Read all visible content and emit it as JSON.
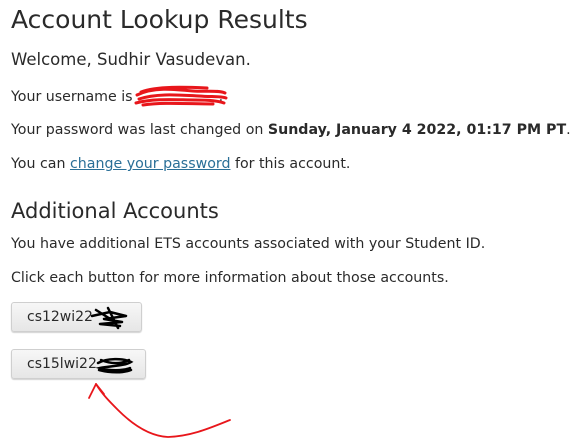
{
  "page_title": "Account Lookup Results",
  "welcome": "Welcome, Sudhir Vasudevan.",
  "username_prefix": "Your username is",
  "username_suffix": ".",
  "password_prefix": "Your password was last changed on ",
  "password_date": "Sunday, January 4 2022, 01:17 PM PT",
  "password_suffix": ".",
  "change_prefix": "You can ",
  "change_link": "change your password",
  "change_suffix": " for this account.",
  "additional_heading": "Additional Accounts",
  "additional_text": "You have additional ETS accounts associated with your Student ID.",
  "click_text": "Click each button for more information about those accounts.",
  "accounts": [
    {
      "label": "cs12wi22"
    },
    {
      "label": "cs15lwi22"
    }
  ],
  "colors": {
    "link": "#2a6f97",
    "annotation_red": "#e8161b",
    "redaction_black": "#000000"
  }
}
